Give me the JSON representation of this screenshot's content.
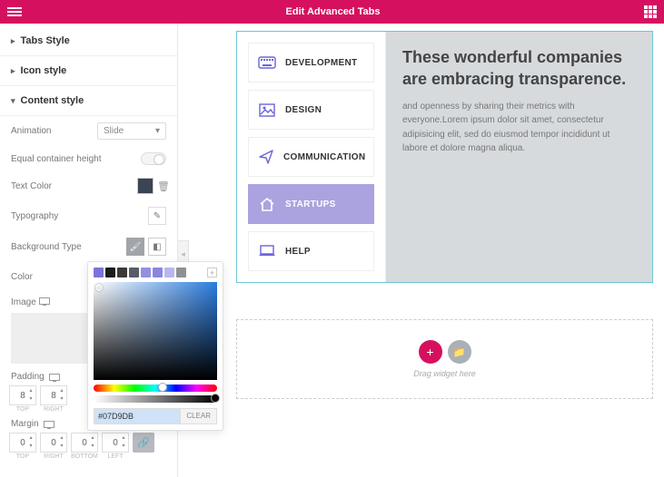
{
  "header": {
    "title": "Edit Advanced Tabs"
  },
  "sections": {
    "tabs_style": "Tabs Style",
    "icon_style": "Icon style",
    "content_style": "Content style"
  },
  "controls": {
    "animation": {
      "label": "Animation",
      "value": "Slide"
    },
    "equal_height": "Equal container height",
    "text_color": "Text Color",
    "typography": "Typography",
    "background_type": "Background Type",
    "color": "Color",
    "image": "Image",
    "padding": "Padding",
    "margin": "Margin"
  },
  "padding": {
    "top": "8",
    "right": "8"
  },
  "margin": {
    "top": "0",
    "right": "0",
    "bottom": "0",
    "left": "0"
  },
  "dim_caps": {
    "top": "TOP",
    "right": "RIGHT",
    "bottom": "BOTTOM",
    "left": "LEFT"
  },
  "picker": {
    "presets": [
      "#7b74d6",
      "#1c1c1c",
      "#3a3a3a",
      "#585d69",
      "#9390e0",
      "#8a87dd",
      "#b9b7ea",
      "#8e9093"
    ],
    "hex": "#07D9DB",
    "clear": "CLEAR"
  },
  "tabs": [
    {
      "icon": "keyboard",
      "label": "DEVELOPMENT"
    },
    {
      "icon": "image",
      "label": "DESIGN"
    },
    {
      "icon": "plane",
      "label": "COMMUNICATION"
    },
    {
      "icon": "home",
      "label": "STARTUPS"
    },
    {
      "icon": "laptop",
      "label": "HELP"
    }
  ],
  "content": {
    "title": "These wonderful companies are embracing transparence.",
    "body": "and openness by sharing their metrics with everyone.Lorem ipsum dolor sit amet, consectetur adipisicing elit, sed do eiusmod tempor incididunt ut labore et dolore magna aliqua."
  },
  "dropzone": "Drag widget here"
}
